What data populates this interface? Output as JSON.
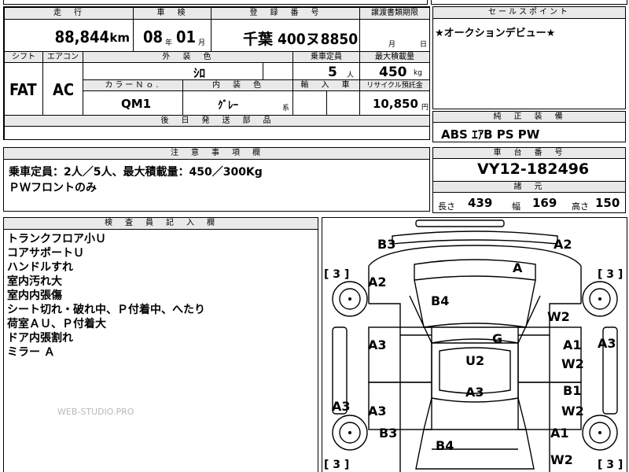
{
  "mileage": {
    "header": "走　行",
    "value": "88,844",
    "unit": "km"
  },
  "inspection": {
    "header": "車　検",
    "year": "08",
    "year_unit": "年",
    "month": "01",
    "month_unit": "月"
  },
  "registration": {
    "header": "登　録　番　号",
    "value": "千葉 400ヌ8850"
  },
  "transfer": {
    "header": "譲渡書類期限",
    "month_unit": "月",
    "day_unit": "日"
  },
  "sales_point": {
    "header": "セールスポイント",
    "text": "★オークションデビュー★"
  },
  "shift": {
    "header": "シフト",
    "value": "FAT"
  },
  "aircon": {
    "header": "エアコン",
    "value": "AC"
  },
  "exterior": {
    "header": "外　装　色",
    "value": "ｼﾛ"
  },
  "capacity": {
    "header": "乗車定員",
    "value": "5",
    "unit": "人"
  },
  "max_load": {
    "header": "最大積載量",
    "value": "450",
    "unit": "kg"
  },
  "color_no": {
    "header": "カラーＮｏ.",
    "value": "QM1"
  },
  "interior": {
    "header": "内　装　色",
    "value": "ｸﾞﾚｰ",
    "suffix": "系"
  },
  "import": {
    "header": "輸　入　車"
  },
  "recycle": {
    "header": "リサイクル預託金",
    "value": "10,850",
    "unit": "円"
  },
  "later_parts": {
    "header": "後　日　発　送　部　品"
  },
  "genuine": {
    "header": "純　正　装　備",
    "value": "ABS ｴｱB PS PW"
  },
  "notes": {
    "header": "注　意　事　項　欄",
    "lines": [
      "乗車定員：2人／5人、最大積載量：450／300Kg",
      "ＰＷフロントのみ"
    ]
  },
  "chassis": {
    "header": "車　台　番　号",
    "value": "VY12-182496"
  },
  "specs": {
    "header": "諸　元",
    "length_label": "長さ",
    "length": "439",
    "width_label": "幅",
    "width": "169",
    "height_label": "高さ",
    "height": "150"
  },
  "inspector": {
    "header": "検　査　員　記　入　欄",
    "lines": [
      "トランクフロア小Ｕ",
      "コアサポートＵ",
      "ハンドルすれ",
      "室内汚れ大",
      "室内内張傷",
      "シート切れ・破れ中、Ｐ付着中、へたり",
      "荷室ＡＵ、Ｐ付着大",
      "ドア内張割れ",
      "ミラー Ａ"
    ]
  },
  "watermark": "WEB-STUDIO.PRO",
  "diagram": {
    "tire_label": "[ 3 ]",
    "labels": {
      "b3_top": "B3",
      "a2_top_right": "A2",
      "a_front": "A",
      "a2_left": "A2",
      "b4_hood": "B4",
      "w2_windshield": "W2",
      "a3_right_edge": "A3",
      "a3_left_front_door": "A3",
      "g_right": "G",
      "a1_right_front": "A1",
      "w2_right_front": "W2",
      "u2_roof": "U2",
      "a3_roof_lower": "A3",
      "a3_left_edge": "A3",
      "a3_left_rear_door": "A3",
      "b1_right_rear": "B1",
      "w2_right_rear": "W2",
      "b3_left_rear": "B3",
      "a1_right_lower": "A1",
      "b4_trunk": "B4",
      "w2_bottom": "W2"
    }
  }
}
